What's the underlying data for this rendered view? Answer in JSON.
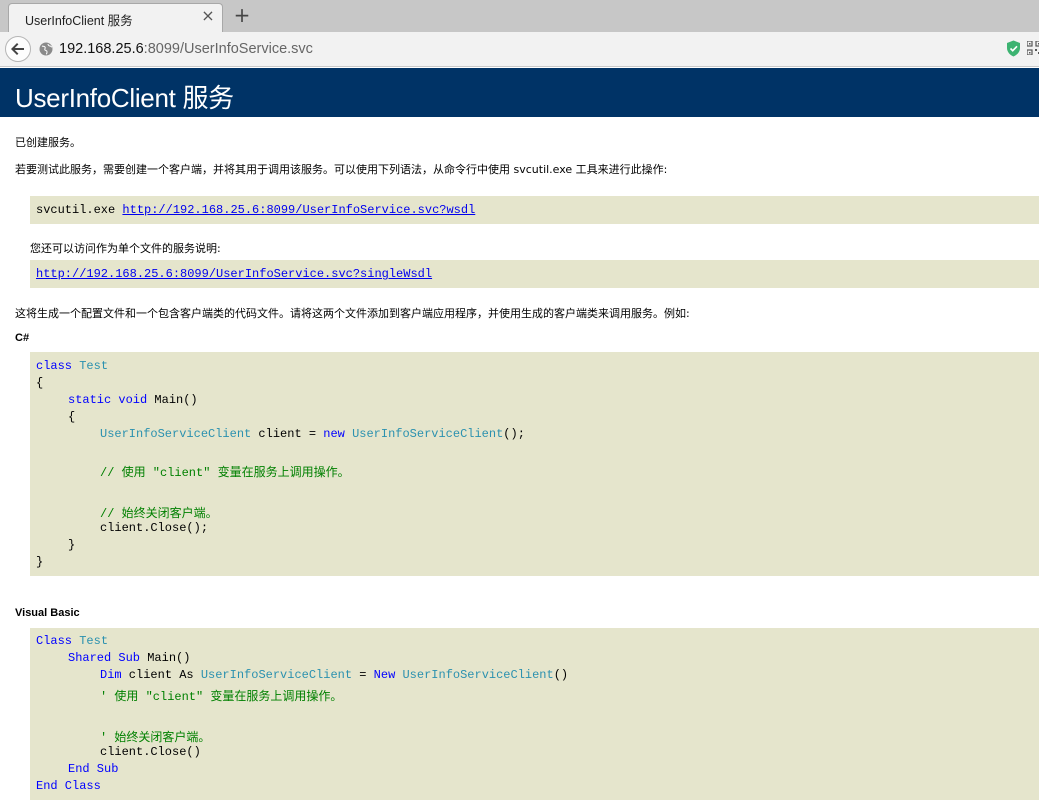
{
  "browser": {
    "tab_title": "UserInfoClient 服务",
    "tab_close": "×",
    "new_tab": "+",
    "url_host": "192.168.25.6",
    "url_rest": ":8099/UserInfoService.svc"
  },
  "page": {
    "title": "UserInfoClient 服务",
    "created": "已创建服务。",
    "instructions": "若要测试此服务，需要创建一个客户端，并将其用于调用该服务。可以使用下列语法，从命令行中使用 svcutil.exe 工具来进行此操作:",
    "svcutil_cmd": "svcutil.exe ",
    "wsdl_link": "http://192.168.25.6:8099/UserInfoService.svc?wsdl",
    "single_file_note": "您还可以访问作为单个文件的服务说明:",
    "single_wsdl_link": "http://192.168.25.6:8099/UserInfoService.svc?singleWsdl",
    "generate_note": "这将生成一个配置文件和一个包含客户端类的代码文件。请将这两个文件添加到客户端应用程序，并使用生成的客户端类来调用服务。例如:",
    "csharp_heading": "C#",
    "vb_heading": "Visual Basic"
  },
  "csharp_code": {
    "l1_kw": "class",
    "l1_ty": "Test",
    "l2": "{",
    "l3_kw": "static void",
    "l3_rest": " Main()",
    "l4": "{",
    "l5_ty": "UserInfoServiceClient",
    "l5_mid": " client = ",
    "l5_kw": "new",
    "l5_ty2": "UserInfoServiceClient",
    "l5_end": "();",
    "l6": "// 使用 \"client\" 变量在服务上调用操作。",
    "l7": "// 始终关闭客户端。",
    "l8": "client.Close();",
    "l9": "}",
    "l10": "}"
  },
  "vb_code": {
    "l1_kw": "Class",
    "l1_ty": "Test",
    "l2_kw": "Shared Sub",
    "l2_rest": " Main()",
    "l3_kw": "Dim",
    "l3_mid": " client As ",
    "l3_ty": "UserInfoServiceClient",
    "l3_eq": " = ",
    "l3_kw2": "New",
    "l3_ty2": "UserInfoServiceClient",
    "l3_end": "()",
    "l4": "' 使用 \"client\" 变量在服务上调用操作。",
    "l5": "' 始终关闭客户端。",
    "l6": "client.Close()",
    "l7": "End Sub",
    "l8": "End Class"
  }
}
